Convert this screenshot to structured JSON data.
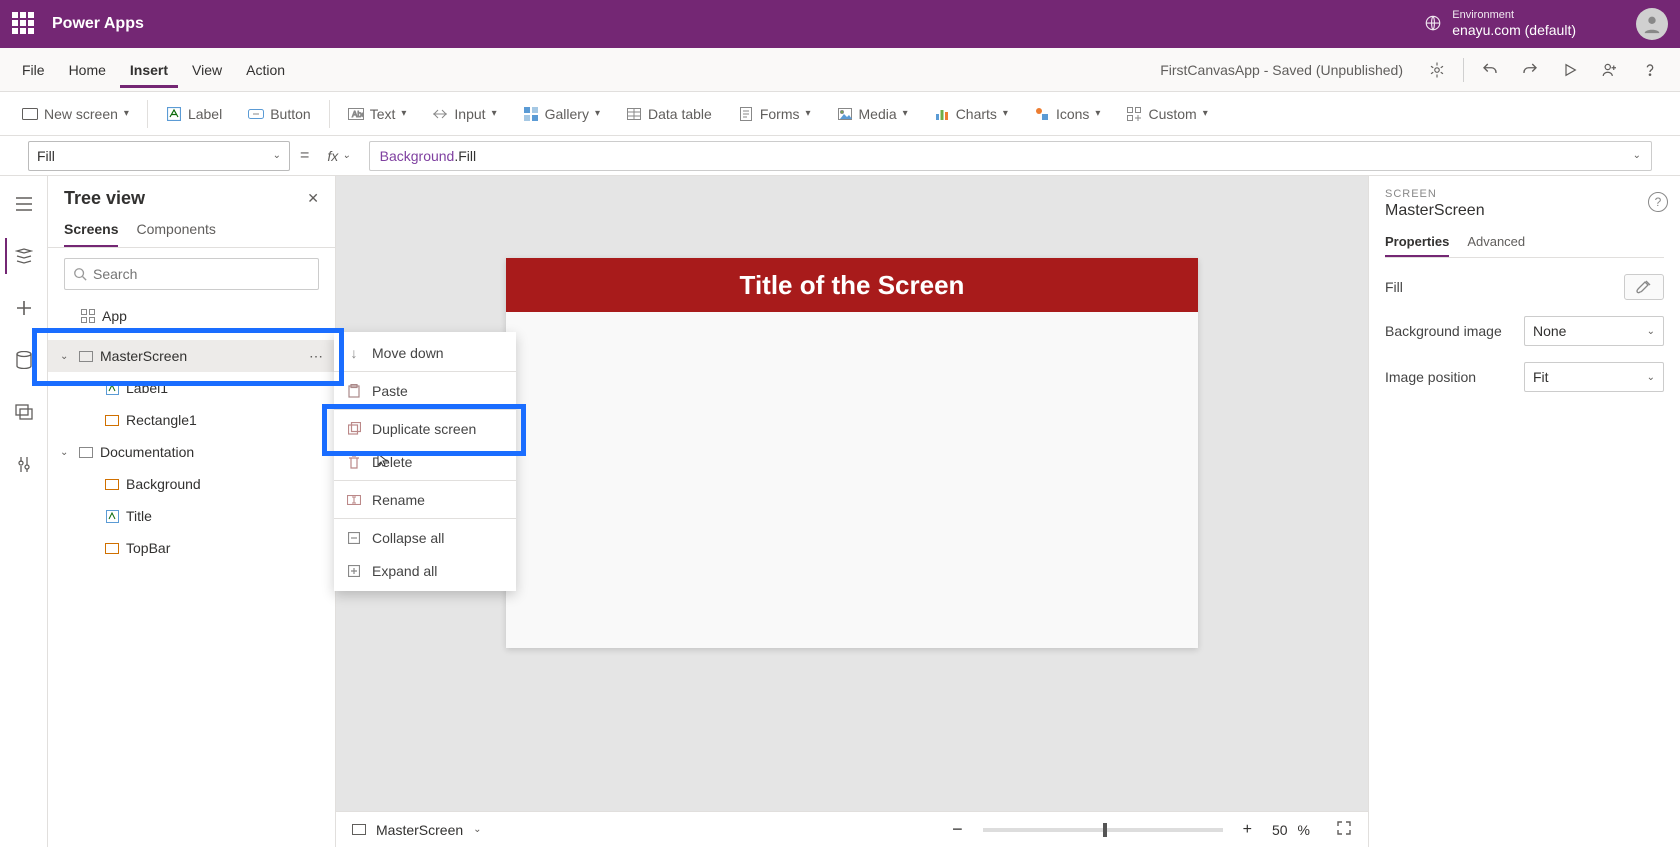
{
  "topbar": {
    "app_name": "Power Apps",
    "environment_label": "Environment",
    "environment_value": "enayu.com (default)"
  },
  "menubar": {
    "items": [
      "File",
      "Home",
      "Insert",
      "View",
      "Action"
    ],
    "active_index": 2,
    "app_status": "FirstCanvasApp - Saved (Unpublished)"
  },
  "ribbon": {
    "new_screen": "New screen",
    "label": "Label",
    "button": "Button",
    "text": "Text",
    "input": "Input",
    "gallery": "Gallery",
    "datatable": "Data table",
    "forms": "Forms",
    "media": "Media",
    "charts": "Charts",
    "icons": "Icons",
    "custom": "Custom"
  },
  "formula": {
    "property": "Fill",
    "fx": "fx",
    "object": "Background",
    "member": ".Fill"
  },
  "tree": {
    "title": "Tree view",
    "tabs": {
      "screens": "Screens",
      "components": "Components"
    },
    "search_placeholder": "Search",
    "app": "App",
    "master_screen": "MasterScreen",
    "label1": "Label1",
    "rectangle1": "Rectangle1",
    "documentation": "Documentation",
    "background": "Background",
    "title_item": "Title",
    "topbar_item": "TopBar"
  },
  "context_menu": {
    "move_down": "Move down",
    "paste": "Paste",
    "duplicate": "Duplicate screen",
    "delete": "Delete",
    "rename": "Rename",
    "collapse_all": "Collapse all",
    "expand_all": "Expand all"
  },
  "canvas": {
    "title": "Title of the Screen"
  },
  "statusbar": {
    "screen_name": "MasterScreen",
    "zoom_minus": "−",
    "zoom_plus": "+",
    "zoom_value": "50",
    "zoom_pct": "%"
  },
  "properties": {
    "section": "SCREEN",
    "screen_name": "MasterScreen",
    "tabs": {
      "properties": "Properties",
      "advanced": "Advanced"
    },
    "fill_label": "Fill",
    "bg_image_label": "Background image",
    "bg_image_value": "None",
    "img_pos_label": "Image position",
    "img_pos_value": "Fit"
  }
}
